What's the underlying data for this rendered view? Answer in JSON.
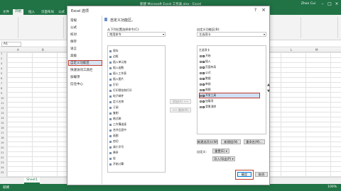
{
  "excel": {
    "title": "新建 Microsoft Excel 工作表.xlsx - Excel",
    "user": "Zhen Cui",
    "tabs": [
      {
        "label": "文件",
        "active": false
      },
      {
        "label": "开始",
        "active": true
      },
      {
        "label": "插入",
        "active": false
      },
      {
        "label": "页面布局",
        "active": false
      },
      {
        "label": "公式",
        "active": false
      },
      {
        "label": "数据",
        "active": false
      },
      {
        "label": "审阅",
        "active": false
      },
      {
        "label": "视图",
        "active": false
      }
    ],
    "namebox": "A1",
    "columns": [
      "A",
      "B",
      "C",
      "D",
      "E",
      "F",
      "G",
      "H",
      "I",
      "J",
      "K",
      "L",
      "M"
    ],
    "rows": [
      "1",
      "2",
      "3",
      "4",
      "5",
      "6",
      "7",
      "8",
      "9",
      "10",
      "11",
      "12",
      "13",
      "14",
      "15",
      "16",
      "17",
      "18",
      "19",
      "20",
      "21",
      "22",
      "23",
      "24",
      "25"
    ],
    "sheet_tab": "Sheet1",
    "status": "就绪",
    "zoom": "100%"
  },
  "dialog": {
    "title": "Excel 选项",
    "nav": [
      "常规",
      "公式",
      "校对",
      "保存",
      "语言",
      "高级",
      "自定义功能区",
      "快速访问工具栏",
      "加载项",
      "信任中心"
    ],
    "selected_nav": "自定义功能区",
    "header": "自定义功能区。",
    "choose_label": "从下列位置选择命令(C):",
    "choose_value": "常用命令",
    "customize_label": "自定义功能区(B):",
    "customize_value": "主选项卡",
    "commands": [
      "保存",
      "边框",
      "插入单元格",
      "插入函数",
      "插入工作表",
      "插入图片",
      "打印",
      "打印预览和打印",
      "电子邮件",
      "定义名称",
      "订阅",
      "复制",
      "格式刷",
      "工作簿连接",
      "合并后居中",
      "画图",
      "剪切",
      "减小字号",
      "降序",
      "宏",
      "开始计算"
    ],
    "add_button": "添加(A) >>",
    "remove_button": "<< 删除(R)",
    "tree_title": "主选项卡",
    "tree_items": [
      {
        "label": "开始",
        "checked": true
      },
      {
        "label": "插入",
        "checked": true
      },
      {
        "label": "页面布局",
        "checked": true
      },
      {
        "label": "公式",
        "checked": true
      },
      {
        "label": "数据",
        "checked": true
      },
      {
        "label": "审阅",
        "checked": true
      },
      {
        "label": "视图",
        "checked": true
      },
      {
        "label": "开发工具",
        "checked": true
      },
      {
        "label": "加载项",
        "checked": true
      },
      {
        "label": "背景消除",
        "checked": true
      }
    ],
    "selected_tree": "开发工具",
    "new_tab": "新建选项卡(W)",
    "new_group": "新建组(N)",
    "rename": "重命名(M)...",
    "custom_label": "自定义:",
    "reset": "重置(E) ▾",
    "import_export": "导入/导出(P) ▾",
    "ok": "确定",
    "cancel": "取消"
  },
  "colors": {
    "excel_green": "#217346",
    "highlight_red": "#c0392b",
    "selection_blue": "#cfe0f5"
  }
}
